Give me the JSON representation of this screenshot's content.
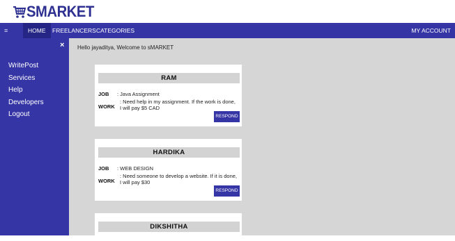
{
  "header": {
    "logo_text": "SMARKET",
    "logo_icon": "cart-icon"
  },
  "nav": {
    "menu_icon": "≡",
    "home": "HOME",
    "freelancers": "FREELANCERS",
    "categories": "CATEGORIES",
    "account": "MY ACCOUNT"
  },
  "sidebar": {
    "close": "×",
    "items": [
      {
        "label": "WritePost"
      },
      {
        "label": "Services"
      },
      {
        "label": "Help"
      },
      {
        "label": "Developers"
      },
      {
        "label": "Logout"
      }
    ]
  },
  "welcome": "Hello jayaditya, Welcome to sMARKET",
  "posts": [
    {
      "name": "RAM",
      "job_label": "JOB",
      "job": ": Java Assignment",
      "work_label": "WORK",
      "work": ": Need help in my assignment. If the work is done, I will pay $5 CAD",
      "button": "RESPOND"
    },
    {
      "name": "HARDIKA",
      "job_label": "JOB",
      "job": ": WEB DESIGN",
      "work_label": "WORK",
      "work": ": Need someone to develop a website. If it is done, I will pay $30",
      "button": "RESPOND"
    },
    {
      "name": "DIKSHITHA"
    }
  ],
  "colors": {
    "brand": "#3535a6",
    "background": "#d6d6d6"
  }
}
